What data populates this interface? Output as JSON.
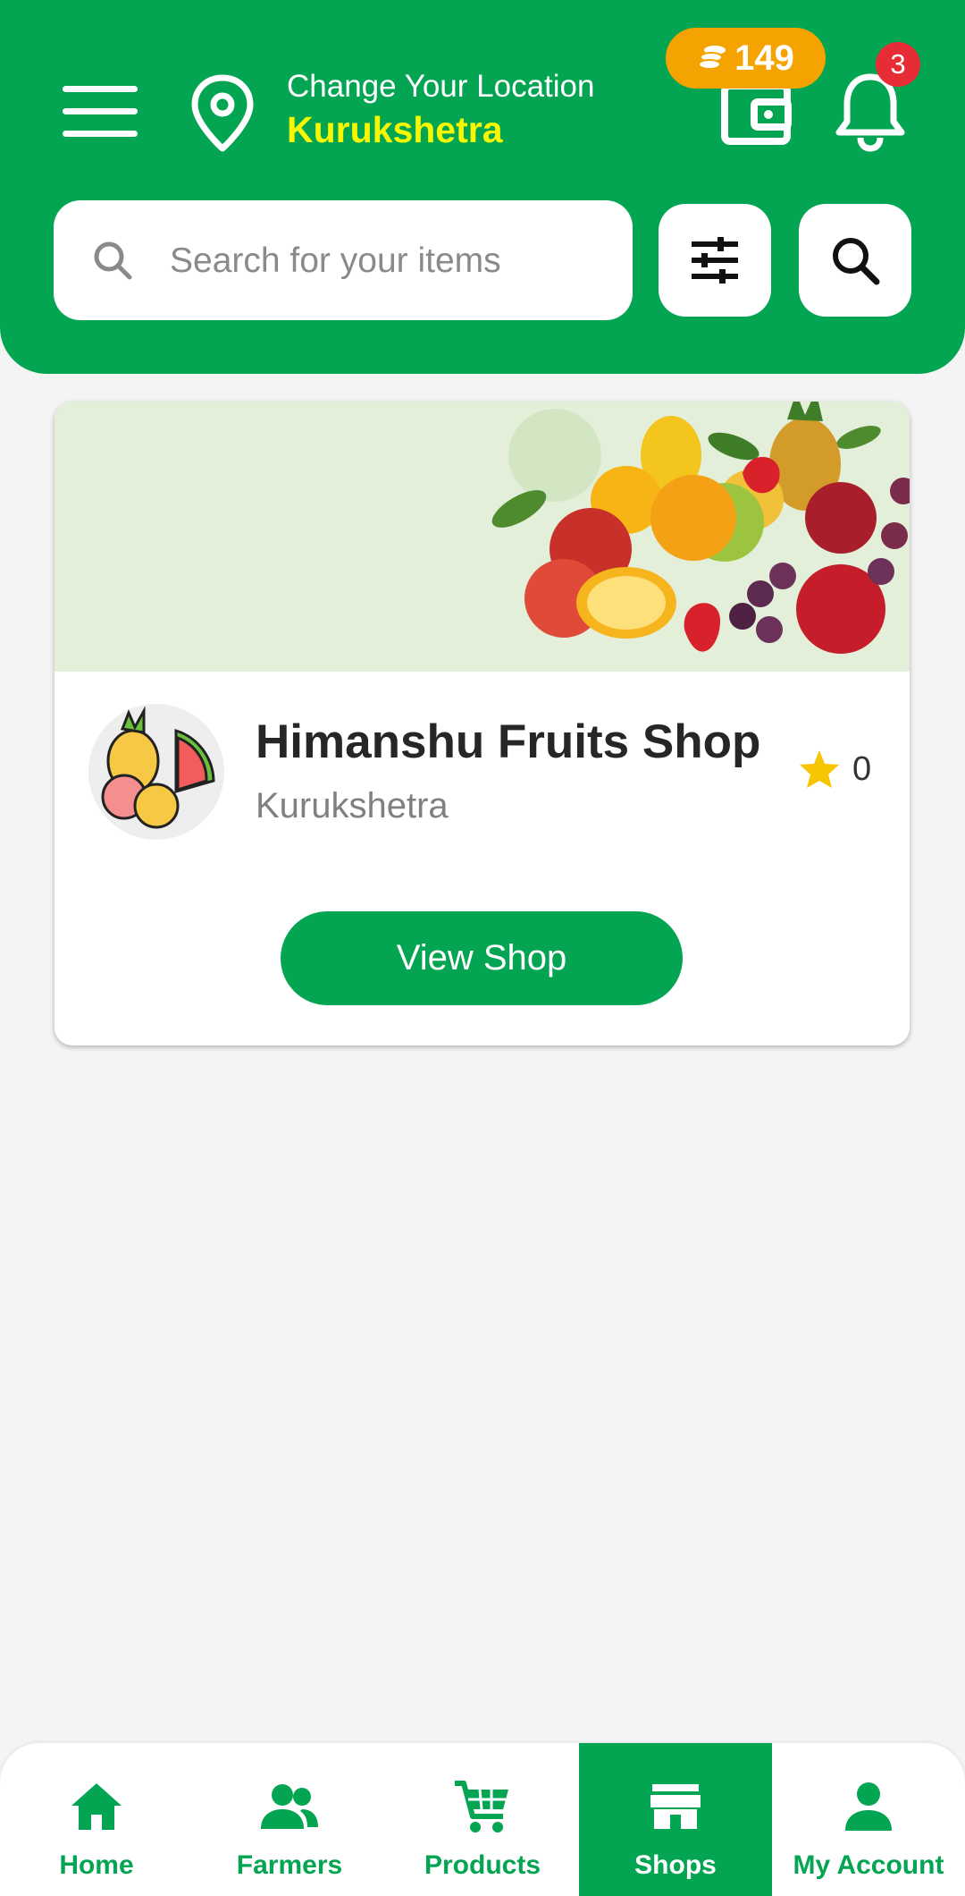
{
  "header": {
    "location_prompt": "Change Your Location",
    "location_city": "Kurukshetra",
    "coins": "149",
    "notification_count": "3"
  },
  "search": {
    "placeholder": "Search for your items",
    "value": ""
  },
  "shop_card": {
    "name": "Himanshu Fruits Shop",
    "city": "Kurukshetra",
    "rating": "0",
    "button_label": "View Shop"
  },
  "bottom_nav": {
    "items": [
      {
        "label": "Home",
        "icon": "home-icon"
      },
      {
        "label": "Farmers",
        "icon": "farmers-icon"
      },
      {
        "label": "Products",
        "icon": "cart-icon"
      },
      {
        "label": "Shops",
        "icon": "store-icon"
      },
      {
        "label": "My Account",
        "icon": "user-icon"
      }
    ],
    "active_index": 3
  },
  "colors": {
    "primary_green": "#04a552",
    "city_yellow": "#f7f700",
    "coin_orange": "#f5a300",
    "badge_red": "#e62c35",
    "star_yellow": "#f7c600",
    "page_background": "#f4f4f4"
  }
}
